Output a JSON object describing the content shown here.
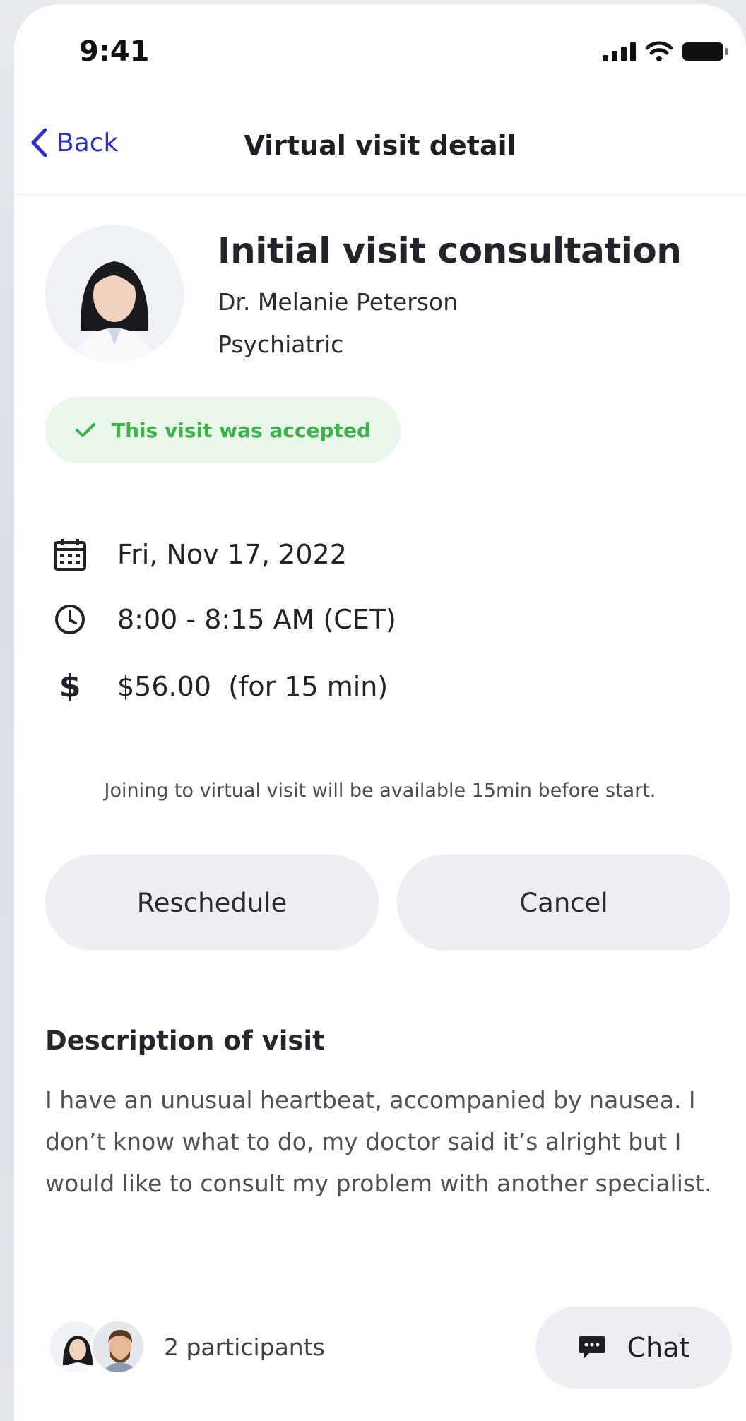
{
  "status_bar": {
    "time": "9:41"
  },
  "nav": {
    "back_label": "Back",
    "title": "Virtual visit detail"
  },
  "visit": {
    "title": "Initial visit consultation",
    "doctor": "Dr. Melanie Peterson",
    "specialty": "Psychiatric",
    "status_text": "This visit was accepted",
    "date": "Fri, Nov 17, 2022",
    "time": "8:00 - 8:15 AM (CET)",
    "price": "$56.00  (for 15 min)",
    "join_note": "Joining to virtual visit will be available 15min before start."
  },
  "actions": {
    "reschedule_label": "Reschedule",
    "cancel_label": "Cancel"
  },
  "description": {
    "title": "Description of visit",
    "text": "I have an unusual heartbeat, accompanied by nausea. I don’t know what to do, my doctor said it’s alright but I would like to consult my problem with another specialist."
  },
  "participants": {
    "label": "2 participants"
  },
  "chat": {
    "label": "Chat"
  },
  "colors": {
    "accent": "#2f2fc0",
    "success": "#3cb24a",
    "success_bg": "#e8f7ea",
    "button_bg": "#eceef2"
  },
  "icons": {
    "back": "chevron-left-icon",
    "status": "checkmark-icon",
    "date": "calendar-icon",
    "time": "clock-icon",
    "price": "dollar-icon",
    "chat": "chat-bubble-icon"
  }
}
